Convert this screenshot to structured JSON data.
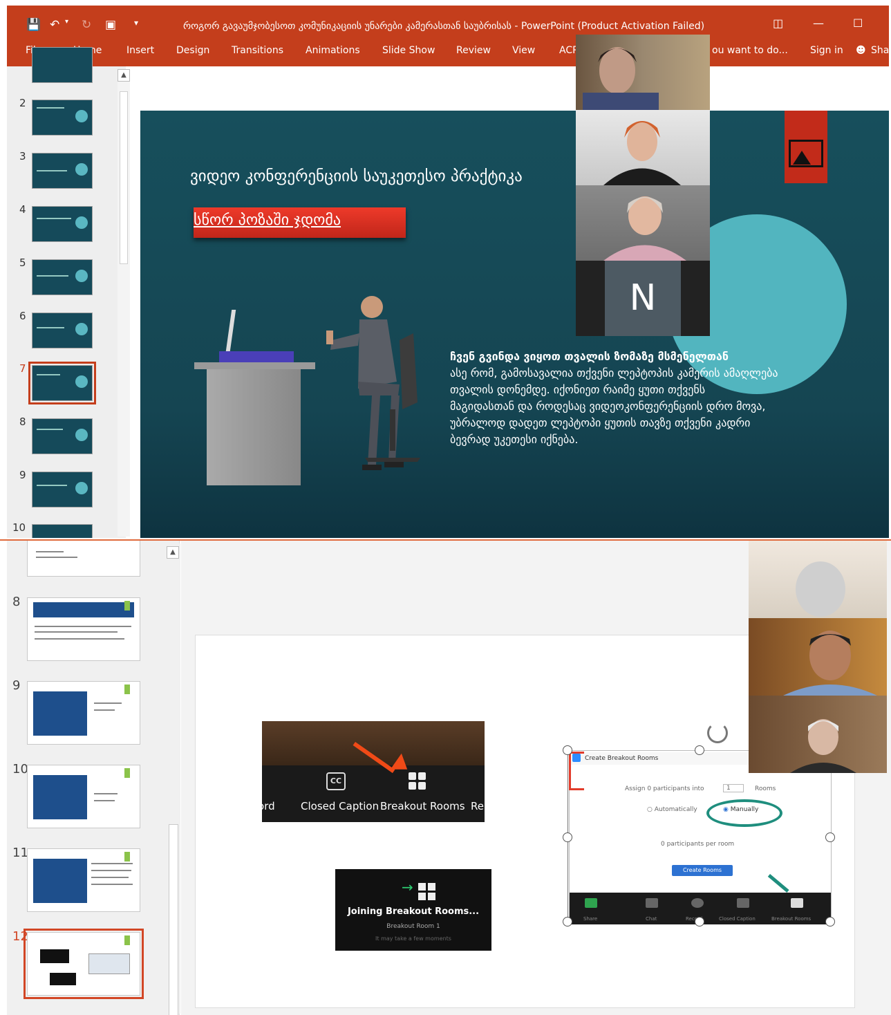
{
  "window": {
    "title": "როგორ გავაუმჯობესოთ კომუნიკაციის უნარები კამერასთან საუბრისას - PowerPoint (Product Activation Failed)"
  },
  "ribbon": {
    "tabs": [
      "File",
      "Home",
      "Insert",
      "Design",
      "Transitions",
      "Animations",
      "Slide Show",
      "Review",
      "View",
      "ACR"
    ],
    "tell_me": "ou want to do...",
    "sign_in": "Sign in",
    "share": "Sha"
  },
  "panel1": {
    "slide_numbers": [
      "2",
      "3",
      "4",
      "5",
      "6",
      "7",
      "8",
      "9",
      "10"
    ],
    "selected": "7"
  },
  "slide1": {
    "title": "ვიდეო კონფერენციის საუკეთესო პრაქტიკა",
    "red_label": "სწორ პოზაში ჯდომა",
    "body_heading": "ჩვენ გვინდა ვიყოთ თვალის ზომაზე მსმენელთან",
    "body_lines": [
      "ასე რომ, გამოსავალია თქვენი ლეპტოპის კამერის ამაღლება",
      "თვალის დონემდე. იქონიეთ რაიმე ყუთი თქვენს",
      "მაგიდასთან და როდესაც ვიდეოკონფერენციის დრო მოვა,",
      "უბრალოდ დადეთ ლეპტოპი ყუთის თავზე თქვენი კადრი",
      "ბევრად უკეთესი იქნება."
    ]
  },
  "video1": {
    "n_label": "N"
  },
  "panel2": {
    "slide_numbers": [
      "8",
      "9",
      "10",
      "11",
      "12"
    ],
    "selected": "12"
  },
  "slide2": {
    "zoom_labels": [
      "ord",
      "Closed Caption",
      "Breakout Rooms",
      "Re"
    ],
    "cc": "CC",
    "join_title": "Joining Breakout Rooms...",
    "join_room": "Breakout Room 1",
    "join_wait": "It may take a few moments",
    "dialog_title": "Create Breakout Rooms",
    "assign_text": "Assign 0 participants into",
    "rooms_count": "1",
    "rooms_label": "Rooms",
    "auto_label": "Automatically",
    "manual_label": "Manually",
    "per_room": "0 participants per room",
    "create_btn": "Create Rooms",
    "toolbar": [
      "Share",
      "Chat",
      "Record",
      "Closed Caption",
      "Breakout Rooms"
    ]
  },
  "colors": {
    "accent": "#c43e1c",
    "slide_bg": "#174f5c",
    "teal_circle": "#52b5bf",
    "red_label": "#e2362a",
    "zoom_blue": "#2d72d2",
    "highlight_green": "#1f8e7e"
  },
  "icons": [
    "save-icon",
    "undo-icon",
    "redo-icon",
    "start-from-beginning-icon",
    "customize-qat-icon",
    "ribbon-display-icon",
    "minimize-icon",
    "maximize-icon",
    "person-icon",
    "picture-icon",
    "cursor-icon",
    "closed-caption-icon",
    "breakout-rooms-icon",
    "rotate-handle-icon"
  ]
}
